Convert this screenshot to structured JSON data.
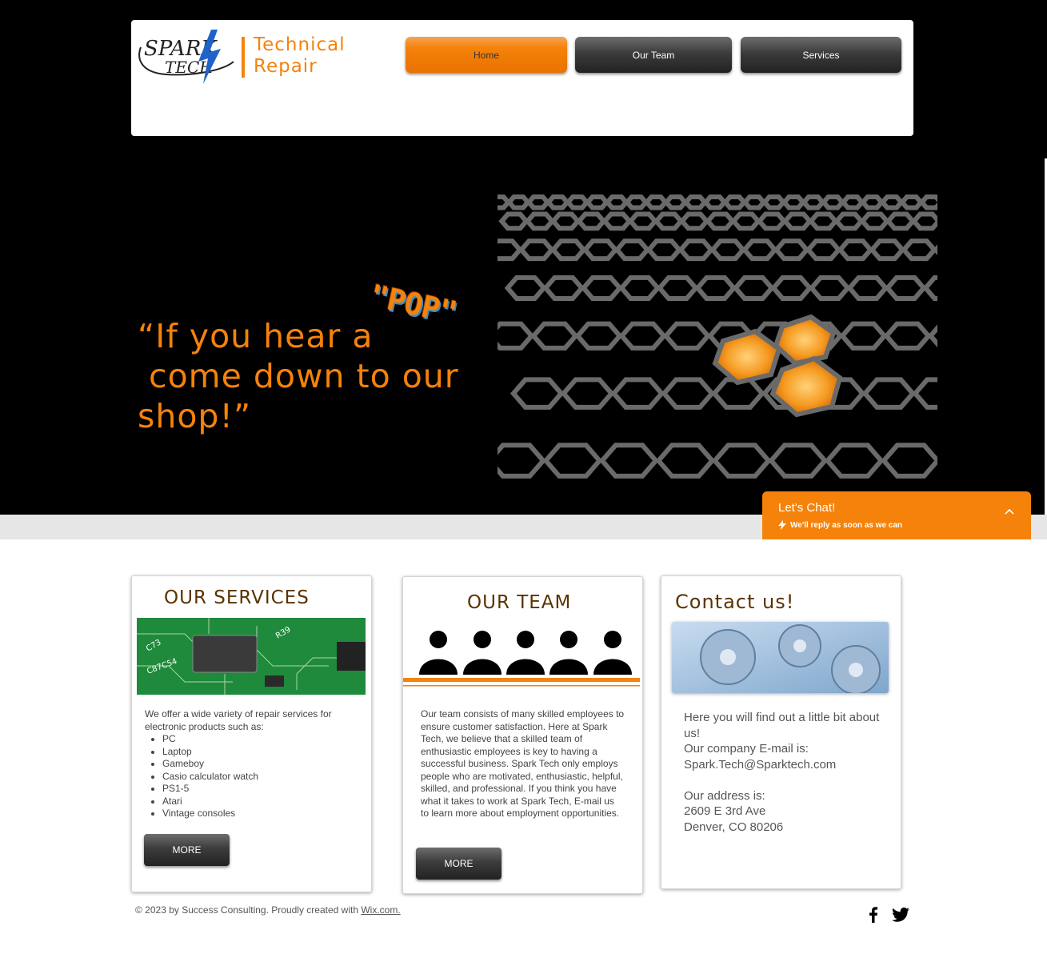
{
  "header": {
    "logo_text": "SPARK TECH",
    "brand_line1": "Technical",
    "brand_line2": "Repair"
  },
  "nav": {
    "items": [
      {
        "label": "Home",
        "active": true
      },
      {
        "label": "Our Team",
        "active": false
      },
      {
        "label": "Services",
        "active": false
      }
    ]
  },
  "hero": {
    "quote_line1": "“If you hear a",
    "quote_line2": " come down to our",
    "quote_line3": "shop!”",
    "pop_text": "\"POP\""
  },
  "chat": {
    "title": "Let's Chat!",
    "subtitle": "We'll reply as soon as we can"
  },
  "services": {
    "title": "OUR SERVICES",
    "intro": "We offer a wide variety of repair services for electronic products such as:",
    "items": [
      "PC",
      "Laptop",
      "Gameboy",
      "Casio calculator watch",
      "PS1-5",
      "Atari",
      "Vintage consoles"
    ],
    "more_label": "MORE"
  },
  "team": {
    "title": "OUR TEAM",
    "text": "Our team consists of many skilled employees to ensure customer satisfaction. Here at Spark Tech, we believe that a skilled team of enthusiastic employees is key to having a successful business. Spark Tech only employs people who are motivated, enthusiastic, helpful, skilled, and professional. If you think you have what it takes to work at Spark Tech, E-mail us to learn more about employment opportunities.",
    "more_label": "MORE"
  },
  "contact": {
    "title": "Contact us!",
    "line1": "Here you will find out a little bit about us!",
    "line2": "Our company E-mail is:",
    "email": "Spark.Tech@Sparktech.com",
    "line3": "Our address is:",
    "address1": "2609 E 3rd Ave",
    "address2": "Denver, CO 80206"
  },
  "footer": {
    "copyright": "© 2023 by Success Consulting. Proudly created with ",
    "link": "Wix.com."
  },
  "colors": {
    "accent": "#f5820a",
    "title_brown": "#5a3300",
    "button_dark": "#3c3c3c"
  },
  "icons": [
    "facebook-icon",
    "twitter-icon",
    "lightning-icon",
    "chevron-up-icon"
  ]
}
